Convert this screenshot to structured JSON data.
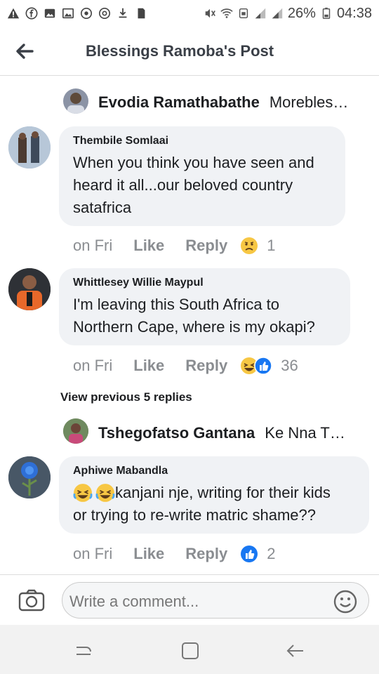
{
  "status_bar": {
    "battery_percent": "26%",
    "time": "04:38"
  },
  "header": {
    "title": "Blessings Ramoba's Post"
  },
  "collapsed_replies": [
    {
      "author": "Evodia Ramathabathe",
      "preview": "Morebles…"
    },
    {
      "author": "Tshegofatso Gantana",
      "preview": "Ke Nna T…"
    }
  ],
  "comments": [
    {
      "author": "Thembile Somlaai",
      "text_lines": [
        "When you think you have seen and",
        "heard it all...our beloved country",
        "satafrica"
      ],
      "time": "on Fri",
      "like_label": "Like",
      "reply_label": "Reply",
      "reaction_count": "1"
    },
    {
      "author": "Whittlesey Willie Maypul",
      "text_lines": [
        "I'm leaving this South Africa to",
        "Northern Cape, where is my okapi?"
      ],
      "time": "on Fri",
      "like_label": "Like",
      "reply_label": "Reply",
      "reaction_count": "36"
    },
    {
      "author": "Aphiwe Mabandla",
      "text_lines": [
        "kanjani nje, writing for their kids",
        "or trying to re-write matric shame??"
      ],
      "time": "on Fri",
      "like_label": "Like",
      "reply_label": "Reply",
      "reaction_count": "2"
    }
  ],
  "view_previous": "View previous 5 replies",
  "composer": {
    "placeholder": "Write a comment..."
  },
  "colors": {
    "bubble_bg": "#f0f2f5",
    "meta_gray": "#8a8d91",
    "fb_blue": "#1877f2",
    "emoji_yellow": "#f7c744"
  }
}
